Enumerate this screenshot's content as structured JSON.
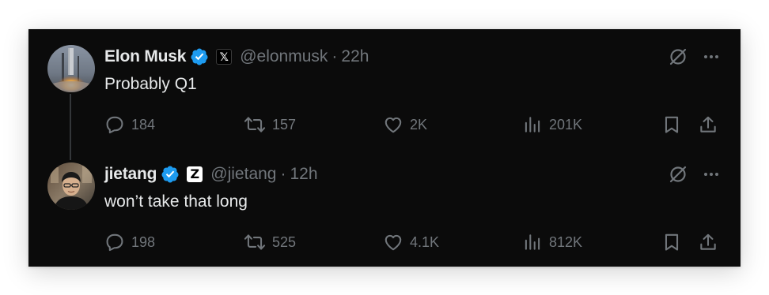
{
  "colors": {
    "background": "#0b0b0b",
    "primary_text": "#e7e9ea",
    "secondary_text": "#71767b",
    "verified_blue": "#1d9bf0",
    "thread_line": "#333639"
  },
  "tweets": [
    {
      "author_name": "Elon Musk",
      "verified": true,
      "affiliation_badge": "𝕏",
      "handle": "@elonmusk",
      "separator": "·",
      "time": "22h",
      "text": "Probably Q1",
      "replies": "184",
      "reposts": "157",
      "likes": "2K",
      "views": "201K",
      "icons": [
        "grok-icon",
        "more-icon",
        "reply-icon",
        "repost-icon",
        "like-icon",
        "views-icon",
        "bookmark-icon",
        "share-icon"
      ]
    },
    {
      "author_name": "jietang",
      "verified": true,
      "affiliation_badge": "Z",
      "handle": "@jietang",
      "separator": "·",
      "time": "12h",
      "text": "won’t take that long",
      "replies": "198",
      "reposts": "525",
      "likes": "4.1K",
      "views": "812K",
      "icons": [
        "grok-icon",
        "more-icon",
        "reply-icon",
        "repost-icon",
        "like-icon",
        "views-icon",
        "bookmark-icon",
        "share-icon"
      ]
    }
  ]
}
